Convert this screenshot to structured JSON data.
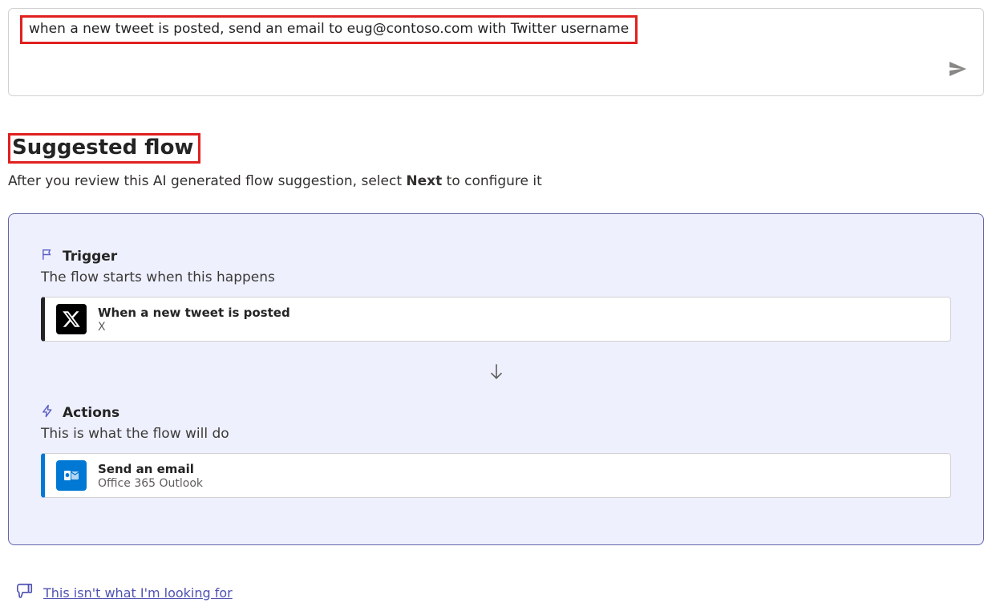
{
  "input": {
    "text": "when a new tweet is posted, send an email to eug@contoso.com with Twitter username"
  },
  "heading": "Suggested flow",
  "subtext_before": "After you review this AI generated flow suggestion, select ",
  "subtext_bold": "Next",
  "subtext_after": " to configure it",
  "flow": {
    "trigger": {
      "label": "Trigger",
      "description": "The flow starts when this happens",
      "step_title": "When a new tweet is posted",
      "step_connector": "X"
    },
    "actions": {
      "label": "Actions",
      "description": "This is what the flow will do",
      "step_title": "Send an email",
      "step_connector": "Office 365 Outlook"
    }
  },
  "feedback": {
    "link_text": "This isn't what I'm looking for"
  }
}
